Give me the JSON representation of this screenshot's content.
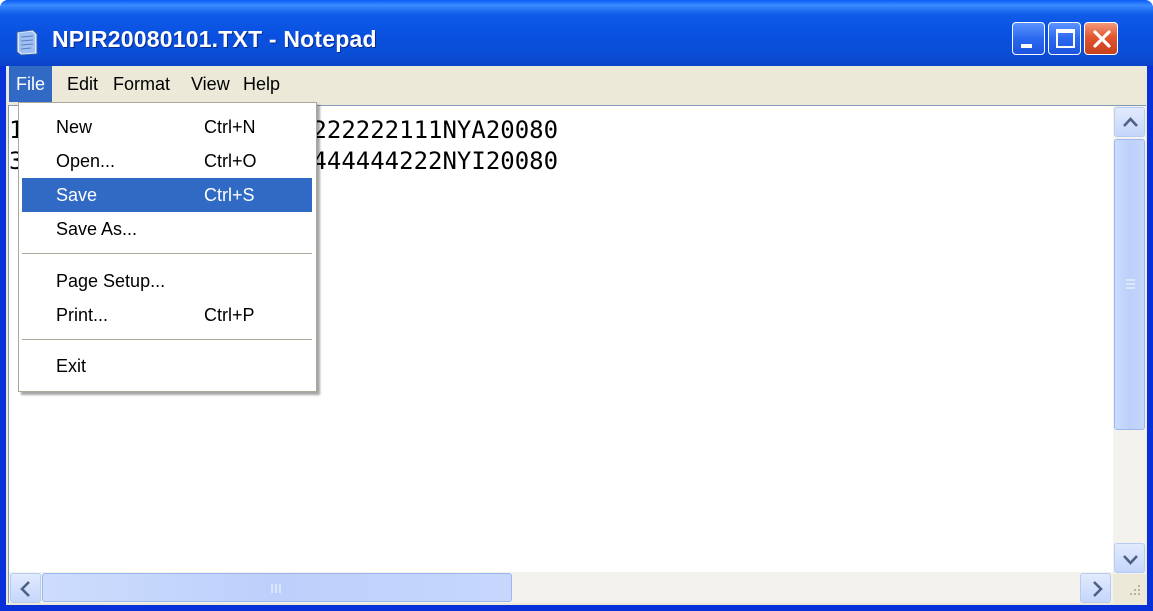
{
  "window": {
    "title": "NPIR20080101.TXT - Notepad",
    "app_icon": "notepad-icon"
  },
  "caption_buttons": {
    "minimize_icon": "minimize-icon",
    "maximize_icon": "maximize-icon",
    "close_icon": "close-icon"
  },
  "menubar": {
    "items": [
      "File",
      "Edit",
      "Format",
      "View",
      "Help"
    ],
    "active": "File"
  },
  "file_menu": {
    "items": [
      {
        "label": "New",
        "shortcut": "Ctrl+N"
      },
      {
        "label": "Open...",
        "shortcut": "Ctrl+O"
      },
      {
        "label": "Save",
        "shortcut": "Ctrl+S",
        "highlighted": true
      },
      {
        "label": "Save As...",
        "shortcut": ""
      },
      {
        "label": "Page Setup...",
        "shortcut": ""
      },
      {
        "label": "Print...",
        "shortcut": "Ctrl+P"
      },
      {
        "label": "Exit",
        "shortcut": ""
      }
    ]
  },
  "editor": {
    "lines": [
      "111111112345678902222222222111NYA20080",
      "333333312345678904444444444222NYI20080"
    ]
  },
  "colors": {
    "titlebar": "#0a4fd6",
    "menu_highlight": "#316ac5",
    "menubar_bg": "#ece9d8",
    "close_button": "#e3562f"
  }
}
